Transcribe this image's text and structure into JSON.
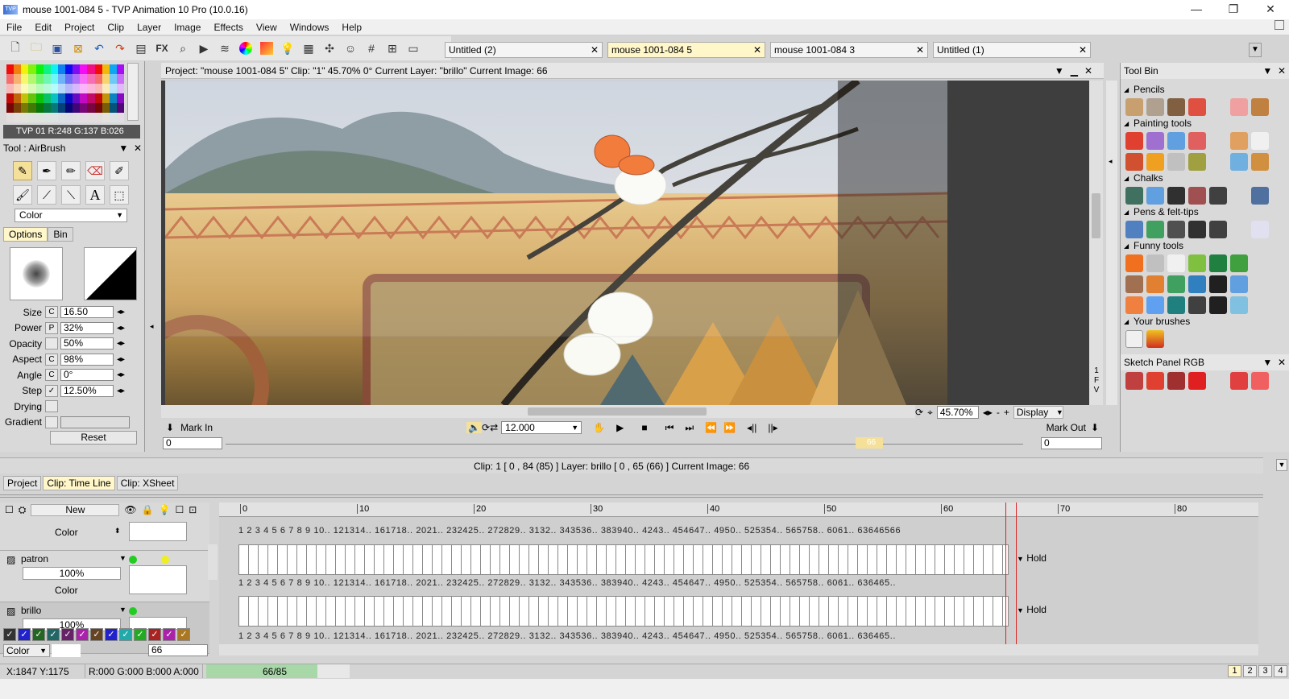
{
  "window": {
    "title": "mouse 1001-084 5 - TVP Animation 10 Pro (10.0.16)",
    "app_icon_text": "TVP"
  },
  "menu": [
    "File",
    "Edit",
    "Project",
    "Clip",
    "Layer",
    "Image",
    "Effects",
    "View",
    "Windows",
    "Help"
  ],
  "toolbar": {
    "fx_label": "FX"
  },
  "doc_tabs": [
    {
      "label": "Untitled (2)",
      "active": false
    },
    {
      "label": "mouse 1001-084 5",
      "active": true
    },
    {
      "label": "mouse 1001-084 3",
      "active": false
    },
    {
      "label": "Untitled (1)",
      "active": false
    }
  ],
  "color_panel": {
    "readout": "TVP 01 R:248 G:137 B:026"
  },
  "tool_panel": {
    "title": "Tool : AirBrush",
    "mode": "Color",
    "tabs": [
      "Options",
      "Bin"
    ],
    "text_tool_glyph": "A"
  },
  "properties": [
    {
      "label": "Size",
      "flag": "C",
      "value": "16.50"
    },
    {
      "label": "Power",
      "flag": "P",
      "value": "32%"
    },
    {
      "label": "Opacity",
      "flag": "",
      "value": "50%"
    },
    {
      "label": "Aspect",
      "flag": "C",
      "value": "98%"
    },
    {
      "label": "Angle",
      "flag": "C",
      "value": "0°"
    },
    {
      "label": "Step",
      "flag": "✓",
      "value": "12.50%"
    },
    {
      "label": "Drying",
      "flag": "",
      "value": ""
    },
    {
      "label": "Gradient",
      "flag": "",
      "value": ""
    }
  ],
  "reset_label": "Reset",
  "viewer": {
    "header": "Project:  \"mouse 1001-084 5\"  Clip: \"1\"   45.70%   0°  Current Layer: \"brillo\"   Current Image: 66",
    "zoom": "45.70%",
    "display_label": "Display",
    "side_letters": [
      "1",
      "F",
      "V"
    ]
  },
  "playback": {
    "mark_in": "Mark In",
    "mark_out": "Mark Out",
    "fps": "12.000",
    "in_frame": "0",
    "out_frame": "0",
    "current_marker": "66"
  },
  "tool_bin": {
    "title": "Tool Bin",
    "sections": [
      "Pencils",
      "Painting tools",
      "Chalks",
      "Pens & felt-tips",
      "Funny tools",
      "Your brushes"
    ],
    "sketch_panel": "Sketch Panel RGB"
  },
  "timeline": {
    "status": "Clip: 1 [ 0 , 84  (85) ]       Layer: brillo [ 0 , 65  (66) ]     Current Image: 66",
    "tabs": [
      {
        "label": "Project",
        "active": false
      },
      {
        "label": "Clip: Time Line",
        "active": true
      },
      {
        "label": "Clip: XSheet",
        "active": false
      }
    ],
    "new_label": "New",
    "ruler_marks": [
      "0",
      "10",
      "20",
      "30",
      "40",
      "50",
      "60",
      "70",
      "80"
    ],
    "frame_numbers_full": "1 2 3 4 5 6 7 8 9 10.. 121314.. 161718.. 2021.. 232425.. 272829.. 3132.. 343536.. 383940.. 4243.. 454647.. 4950.. 525354.. 565758.. 6061.. 63646566",
    "frame_numbers": "1 2 3 4 5 6 7 8 9 10.. 121314.. 161718.. 2021.. 232425.. 272829.. 3132.. 343536.. 383940.. 4243.. 454647.. 4950.. 525354.. 565758.. 6061.. 636465..",
    "layers": [
      {
        "name": "patron",
        "opacity": "100%",
        "mode": "Color",
        "hold": "Hold"
      },
      {
        "name": "brillo",
        "opacity": "100%",
        "mode": "",
        "hold": "Hold"
      }
    ],
    "top_layer_mode": "Color",
    "bottom_mode": "Color",
    "bottom_frame": "66"
  },
  "statusbar": {
    "coords": "X:1847  Y:1175",
    "color": "R:000 G:000 B:000 A:000",
    "progress_text": "66/85",
    "progress": 0.776,
    "pages": [
      "1",
      "2",
      "3",
      "4"
    ]
  }
}
